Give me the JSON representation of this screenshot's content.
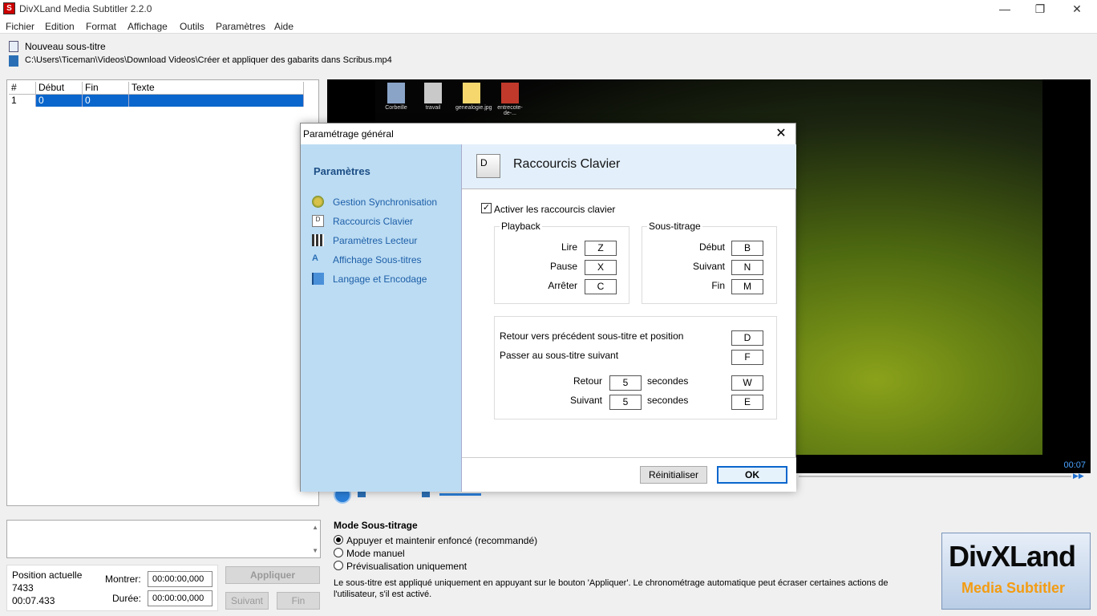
{
  "window": {
    "title": "DivXLand Media Subtitler 2.2.0",
    "icon_letter": "S"
  },
  "menu": [
    "Fichier",
    "Edition",
    "Format",
    "Affichage",
    "Outils",
    "Paramètres",
    "Aide"
  ],
  "info": {
    "new_subtitle": "Nouveau sous-titre",
    "file_path": "C:\\Users\\Ticeman\\Videos\\Download Videos\\Créer et appliquer des gabarits dans Scribus.mp4"
  },
  "table": {
    "headers": [
      "#",
      "Début",
      "Fin",
      "Texte"
    ],
    "rows": [
      [
        "1",
        "0",
        "0",
        ""
      ]
    ]
  },
  "video": {
    "desktop_icons": [
      "Corbeille",
      "travail",
      "genealogie.jpg",
      "entrecote-de-..."
    ],
    "time": "00:07"
  },
  "dialog": {
    "title": "Paramétrage général",
    "side_title": "Paramètres",
    "side_items": [
      "Gestion Synchronisation",
      "Raccourcis Clavier",
      "Paramètres Lecteur",
      "Affichage Sous-titres",
      "Langage et Encodage"
    ],
    "header_key": "D",
    "header_title": "Raccourcis Clavier",
    "enable_label": "Activer les raccourcis clavier",
    "enable_checked": true,
    "playback": {
      "label": "Playback",
      "items": [
        {
          "label": "Lire",
          "key": "Z"
        },
        {
          "label": "Pause",
          "key": "X"
        },
        {
          "label": "Arrêter",
          "key": "C"
        }
      ]
    },
    "subtitling": {
      "label": "Sous-titrage",
      "items": [
        {
          "label": "Début",
          "key": "B"
        },
        {
          "label": "Suivant",
          "key": "N"
        },
        {
          "label": "Fin",
          "key": "M"
        }
      ]
    },
    "nav": {
      "prev_label": "Retour vers précédent sous-titre et position",
      "prev_key": "D",
      "next_label": "Passer au sous-titre suivant",
      "next_key": "F",
      "back_label": "Retour",
      "back_value": "5",
      "back_key": "W",
      "fwd_label": "Suivant",
      "fwd_value": "5",
      "fwd_key": "E",
      "seconds": "secondes"
    },
    "reset_button": "Réinitialiser",
    "ok_button": "OK"
  },
  "bottom": {
    "position_label": "Position actuelle",
    "position_value": "7433",
    "position_time": "00:07.433",
    "show_label": "Montrer:",
    "show_value": "00:00:00,000",
    "duration_label": "Durée:",
    "duration_value": "00:00:00,000",
    "apply_button": "Appliquer",
    "next_button": "Suivant",
    "end_button": "Fin",
    "mode_title": "Mode Sous-titrage",
    "modes": [
      {
        "label": "Appuyer et maintenir enfoncé (recommandé)",
        "selected": true
      },
      {
        "label": "Mode manuel",
        "selected": false
      },
      {
        "label": "Prévisualisation uniquement",
        "selected": false
      }
    ],
    "description": "Le sous-titre est appliqué uniquement en appuyant sur le bouton 'Appliquer'. Le chronométrage automatique peut écraser certaines actions de l'utilisateur, s'il est activé."
  },
  "logo": {
    "main": "DivXLand",
    "sub": "Media Subtitler"
  },
  "colors": {
    "accent": "#0a66cc",
    "dialog_side": "#bcdcf3",
    "logo_orange": "#f39c12"
  }
}
